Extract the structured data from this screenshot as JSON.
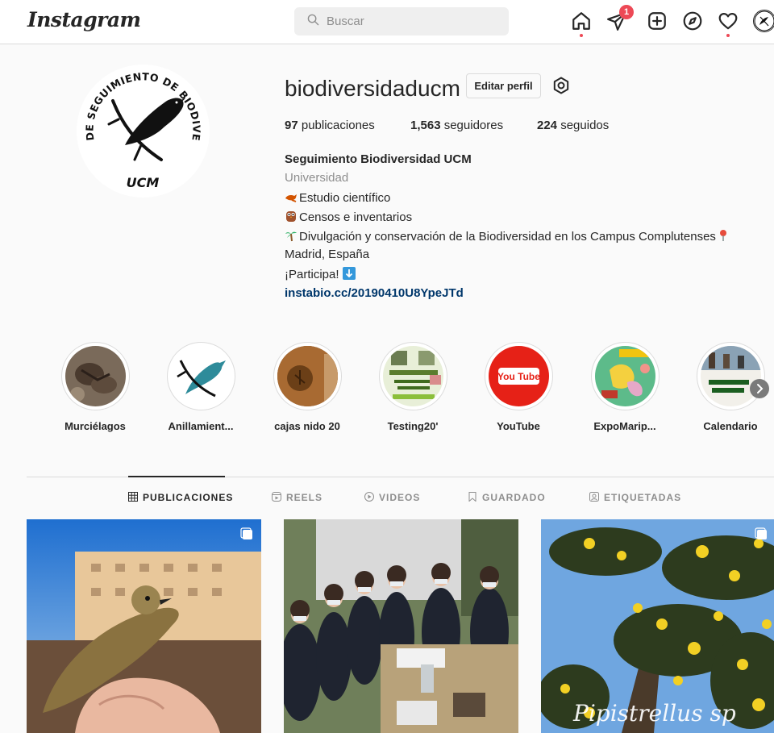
{
  "nav": {
    "logo": "Instagram",
    "search_placeholder": "Buscar",
    "inbox_badge": "1",
    "icons": [
      "home-icon",
      "direct-icon",
      "new-post-icon",
      "explore-icon",
      "activity-icon",
      "profile-avatar"
    ]
  },
  "profile": {
    "username": "biodiversidaducm",
    "edit_label": "Editar perfil",
    "avatar_text_top": "GRUPO DE SEGUIMIENTO DE BIODIVERSIDAD",
    "avatar_text_bottom": "UCM",
    "stats": {
      "posts_count": "97",
      "posts_label": "publicaciones",
      "followers_count": "1,563",
      "followers_label": "seguidores",
      "following_count": "224",
      "following_label": "seguidos"
    },
    "bio": {
      "name": "Seguimiento Biodiversidad UCM",
      "category": "Universidad",
      "line1": "Estudio científico",
      "line2": "Censos e inventarios",
      "line3": "Divulgación y conservación de la Biodiversidad en los Campus Complutenses",
      "line4": "Madrid, España",
      "line5": "¡Participa! ",
      "link": "instabio.cc/20190410U8YpeJTd"
    }
  },
  "highlights": [
    {
      "label": "Murciélagos"
    },
    {
      "label": "Anillamient..."
    },
    {
      "label": "cajas nido 20"
    },
    {
      "label": "Testing20'"
    },
    {
      "label": "YouTube",
      "logo_text": "You Tube"
    },
    {
      "label": "ExpoMarip..."
    },
    {
      "label": "Calendario"
    }
  ],
  "tabs": [
    {
      "label": "PUBLICACIONES",
      "icon": "grid-icon",
      "active": true
    },
    {
      "label": "REELS",
      "icon": "reels-icon",
      "active": false
    },
    {
      "label": "VIDEOS",
      "icon": "video-icon",
      "active": false
    },
    {
      "label": "GUARDADO",
      "icon": "bookmark-icon",
      "active": false
    },
    {
      "label": "ETIQUETADAS",
      "icon": "tagged-icon",
      "active": false
    }
  ],
  "posts": [
    {
      "alt": "bird-in-hand"
    },
    {
      "alt": "group-photo"
    },
    {
      "alt": "tree-leaves",
      "caption": "Pipistrellus sp"
    }
  ],
  "colors": {
    "accent_red": "#ed4956",
    "link_blue": "#00376b",
    "border": "#dbdbdb",
    "background": "#fafafa"
  }
}
